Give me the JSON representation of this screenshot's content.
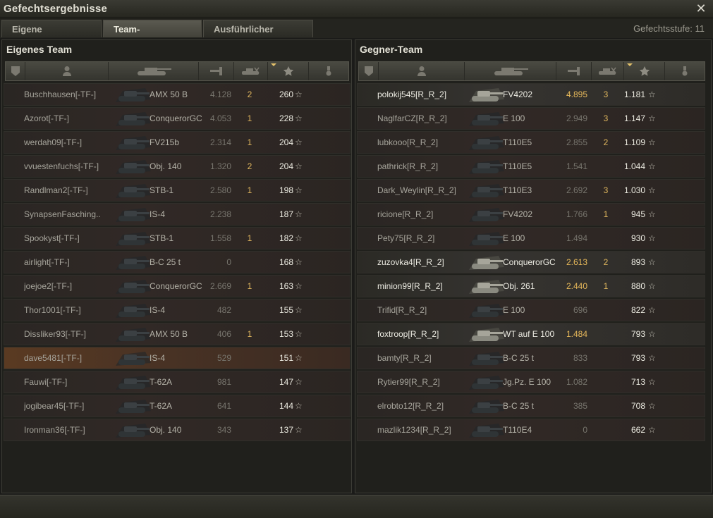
{
  "window": {
    "title": "Gefechtsergebnisse",
    "close_icon": "close-icon"
  },
  "tabs": [
    {
      "label": "Eigene Auswertung",
      "active": false
    },
    {
      "label": "Team-Auswertung",
      "active": true
    },
    {
      "label": "Ausführlicher Bericht",
      "active": false
    }
  ],
  "battle_level": "Gefechtsstufe: 11",
  "columns": {
    "icons": [
      "squad-icon",
      "player-icon",
      "tank-icon",
      "damage-icon",
      "kills-icon",
      "xp-star-icon",
      "medal-icon"
    ],
    "sorted_column": "xp"
  },
  "own_team": {
    "title": "Eigenes Team",
    "players": [
      {
        "name": "Buschhausen[-TF-]",
        "vehicle": "AMX 50 B",
        "damage": "4.128",
        "kills": "2",
        "xp": "260",
        "state": "dead"
      },
      {
        "name": "Azorot[-TF-]",
        "vehicle": "ConquerorGC",
        "damage": "4.053",
        "kills": "1",
        "xp": "228",
        "state": "dead"
      },
      {
        "name": "werdah09[-TF-]",
        "vehicle": "FV215b",
        "damage": "2.314",
        "kills": "1",
        "xp": "204",
        "state": "dead"
      },
      {
        "name": "vvuestenfuchs[-TF-]",
        "vehicle": "Obj. 140",
        "damage": "1.320",
        "kills": "2",
        "xp": "204",
        "state": "dead"
      },
      {
        "name": "Randlman2[-TF-]",
        "vehicle": "STB-1",
        "damage": "2.580",
        "kills": "1",
        "xp": "198",
        "state": "dead"
      },
      {
        "name": "SynapsenFasching..",
        "vehicle": "IS-4",
        "damage": "2.238",
        "kills": "",
        "xp": "187",
        "state": "dead"
      },
      {
        "name": "Spookyst[-TF-]",
        "vehicle": "STB-1",
        "damage": "1.558",
        "kills": "1",
        "xp": "182",
        "state": "dead"
      },
      {
        "name": "airlight[-TF-]",
        "vehicle": "B-C 25 t",
        "damage": "0",
        "kills": "",
        "xp": "168",
        "state": "dead"
      },
      {
        "name": "joejoe2[-TF-]",
        "vehicle": "ConquerorGC",
        "damage": "2.669",
        "kills": "1",
        "xp": "163",
        "state": "dead"
      },
      {
        "name": "Thor1001[-TF-]",
        "vehicle": "IS-4",
        "damage": "482",
        "kills": "",
        "xp": "155",
        "state": "dead"
      },
      {
        "name": "Dissliker93[-TF-]",
        "vehicle": "AMX 50 B",
        "damage": "406",
        "kills": "1",
        "xp": "153",
        "state": "dead"
      },
      {
        "name": "dave5481[-TF-]",
        "vehicle": "IS-4",
        "damage": "529",
        "kills": "",
        "xp": "151",
        "state": "self"
      },
      {
        "name": "Fauwi[-TF-]",
        "vehicle": "T-62A",
        "damage": "981",
        "kills": "",
        "xp": "147",
        "state": "dead"
      },
      {
        "name": "jogibear45[-TF-]",
        "vehicle": "T-62A",
        "damage": "641",
        "kills": "",
        "xp": "144",
        "state": "dead"
      },
      {
        "name": "Ironman36[-TF-]",
        "vehicle": "Obj. 140",
        "damage": "343",
        "kills": "",
        "xp": "137",
        "state": "dead"
      }
    ]
  },
  "enemy_team": {
    "title": "Gegner-Team",
    "players": [
      {
        "name": "polokij545[R_R_2]",
        "vehicle": "FV4202",
        "damage": "4.895",
        "kills": "3",
        "xp": "1.181",
        "state": "alive"
      },
      {
        "name": "NaglfarCZ[R_R_2]",
        "vehicle": "E 100",
        "damage": "2.949",
        "kills": "3",
        "xp": "1.147",
        "state": "dead"
      },
      {
        "name": "lubkooo[R_R_2]",
        "vehicle": "T110E5",
        "damage": "2.855",
        "kills": "2",
        "xp": "1.109",
        "state": "dead"
      },
      {
        "name": "pathrick[R_R_2]",
        "vehicle": "T110E5",
        "damage": "1.541",
        "kills": "",
        "xp": "1.044",
        "state": "dead"
      },
      {
        "name": "Dark_Weylin[R_R_2]",
        "vehicle": "T110E3",
        "damage": "2.692",
        "kills": "3",
        "xp": "1.030",
        "state": "dead"
      },
      {
        "name": "ricione[R_R_2]",
        "vehicle": "FV4202",
        "damage": "1.766",
        "kills": "1",
        "xp": "945",
        "state": "dead"
      },
      {
        "name": "Pety75[R_R_2]",
        "vehicle": "E 100",
        "damage": "1.494",
        "kills": "",
        "xp": "930",
        "state": "dead"
      },
      {
        "name": "zuzovka4[R_R_2]",
        "vehicle": "ConquerorGC",
        "damage": "2.613",
        "kills": "2",
        "xp": "893",
        "state": "alive"
      },
      {
        "name": "minion99[R_R_2]",
        "vehicle": "Obj. 261",
        "damage": "2.440",
        "kills": "1",
        "xp": "880",
        "state": "alive"
      },
      {
        "name": "Trifid[R_R_2]",
        "vehicle": "E 100",
        "damage": "696",
        "kills": "",
        "xp": "822",
        "state": "dead"
      },
      {
        "name": "foxtroop[R_R_2]",
        "vehicle": "WT auf E 100",
        "damage": "1.484",
        "kills": "",
        "xp": "793",
        "state": "alive"
      },
      {
        "name": "bamty[R_R_2]",
        "vehicle": "B-C 25 t",
        "damage": "833",
        "kills": "",
        "xp": "793",
        "state": "dead"
      },
      {
        "name": "Rytier99[R_R_2]",
        "vehicle": "Jg.Pz. E 100",
        "damage": "1.082",
        "kills": "",
        "xp": "713",
        "state": "dead"
      },
      {
        "name": "elrobto12[R_R_2]",
        "vehicle": "B-C 25 t",
        "damage": "385",
        "kills": "",
        "xp": "708",
        "state": "dead"
      },
      {
        "name": "mazlik1234[R_R_2]",
        "vehicle": "T110E4",
        "damage": "0",
        "kills": "",
        "xp": "662",
        "state": "dead"
      }
    ]
  },
  "colors": {
    "accent": "#e3c16a",
    "self_row": "#5a3a22",
    "alive_text": "#ecebe2",
    "dead_text": "#a6a49b"
  }
}
